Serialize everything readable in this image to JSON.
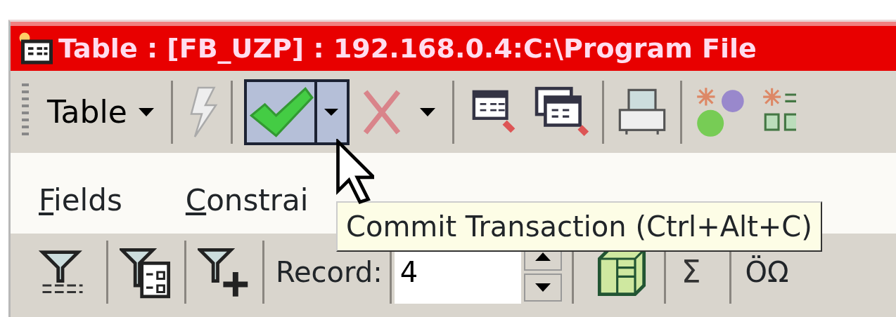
{
  "window": {
    "title": "Table : [FB_UZP] : 192.168.0.4:C:\\Program File"
  },
  "toolbar": {
    "menu_label": "Table",
    "commit_highlighted": true
  },
  "tabs": [
    {
      "label": "Fields",
      "mnemonic": true
    },
    {
      "label": "Constrai",
      "mnemonic": true
    }
  ],
  "filter_bar": {
    "record_label": "Record:",
    "record_value": "4",
    "sum_symbol": "Σ",
    "special_symbols": "ÖΩ"
  },
  "tooltip": {
    "text": "Commit Transaction (Ctrl+Alt+C)"
  }
}
